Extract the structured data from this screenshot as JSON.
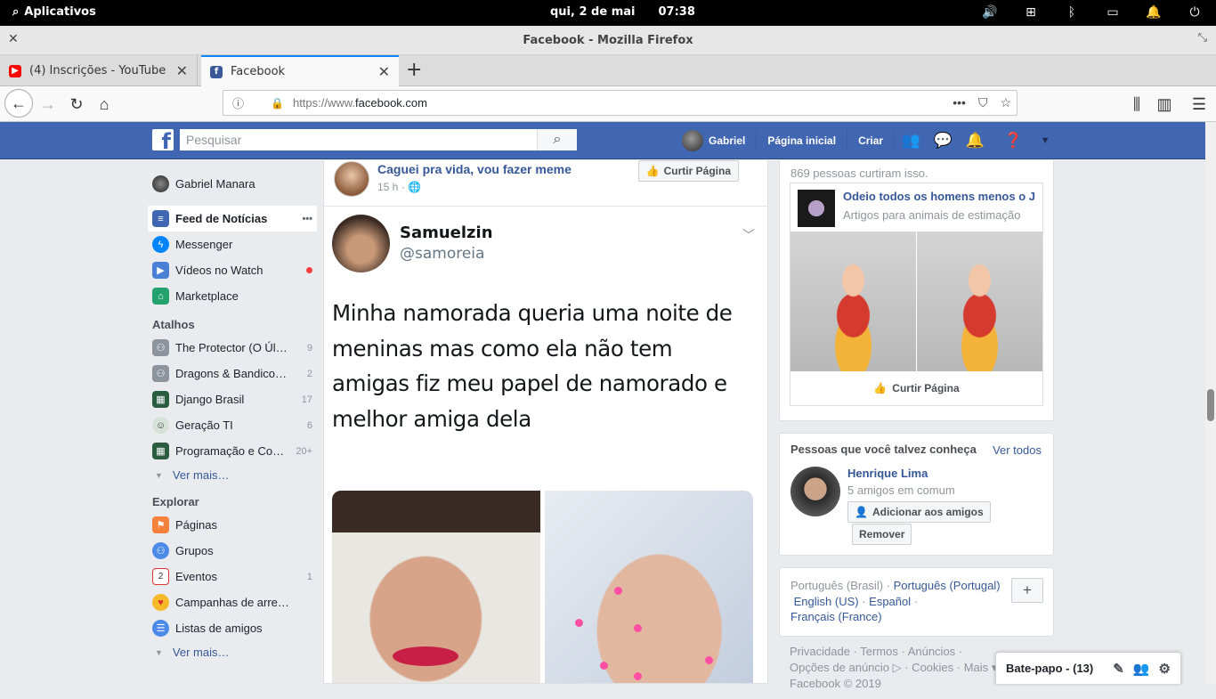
{
  "system": {
    "apps": "Aplicativos",
    "date": "qui, 2 de mai",
    "time": "07:38"
  },
  "window": {
    "title": "Facebook - Mozilla Firefox"
  },
  "tabs": [
    {
      "label": "(4) Inscrições - YouTube",
      "color": "#ff0000"
    },
    {
      "label": "Facebook",
      "color": "#3b5998"
    }
  ],
  "nav": {
    "url_proto": "https://www.",
    "url_host": "facebook.com"
  },
  "fb": {
    "search_placeholder": "Pesquisar",
    "user": "Gabriel",
    "home": "Página inicial",
    "create": "Criar"
  },
  "left": {
    "profile": "Gabriel Manara",
    "main": [
      {
        "label": "Feed de Notícias",
        "more": "•••"
      },
      {
        "label": "Messenger"
      },
      {
        "label": "Vídeos no Watch"
      },
      {
        "label": "Marketplace"
      }
    ],
    "shortcuts_title": "Atalhos",
    "shortcuts": [
      {
        "label": "The Protector (O Úl…",
        "count": "9"
      },
      {
        "label": "Dragons & Bandico…",
        "count": "2"
      },
      {
        "label": "Django Brasil",
        "count": "17"
      },
      {
        "label": "Geração TI",
        "count": "6"
      },
      {
        "label": "Programação e Co…",
        "count": "20+"
      }
    ],
    "see_more": "Ver mais…",
    "explore_title": "Explorar",
    "explore": [
      {
        "label": "Páginas",
        "count": ""
      },
      {
        "label": "Grupos",
        "count": ""
      },
      {
        "label": "Eventos",
        "count": "1"
      },
      {
        "label": "Campanhas de arre…",
        "count": ""
      },
      {
        "label": "Listas de amigos",
        "count": ""
      }
    ],
    "see_more2": "Ver mais…"
  },
  "post": {
    "page": "Caguei pra vida, vou fazer meme",
    "meta": "15 h ·",
    "like_page": "Curtir Página",
    "tweet": {
      "name": "Samuelzin",
      "handle": "@samoreia",
      "text": "Minha namorada queria uma noite de meninas mas como ela não tem amigas fiz meu papel de namorado e melhor amiga dela"
    }
  },
  "right": {
    "ad_likes": "869 pessoas curtiram isso.",
    "ad_name": "Odeio todos os homens menos o J",
    "ad_cat": "Artigos para animais de estimação",
    "ad_like": "Curtir Página",
    "pymk_title": "Pessoas que você talvez conheça",
    "pymk_all": "Ver todos",
    "person": "Henrique Lima",
    "mutual": "5 amigos em comum",
    "add": "Adicionar aos amigos",
    "remove": "Remover",
    "lang_current": "Português (Brasil)",
    "langs": [
      "Português (Portugal)",
      "English (US)",
      "Español",
      "Français (France)"
    ],
    "footer1": "Privacidade · Termos · Anúncios ·",
    "footer2": "Opções de anúncio ▷ · Cookies · Mais ▾",
    "footer3": "Facebook © 2019"
  },
  "chat": {
    "label": "Bate-papo - (13)"
  }
}
